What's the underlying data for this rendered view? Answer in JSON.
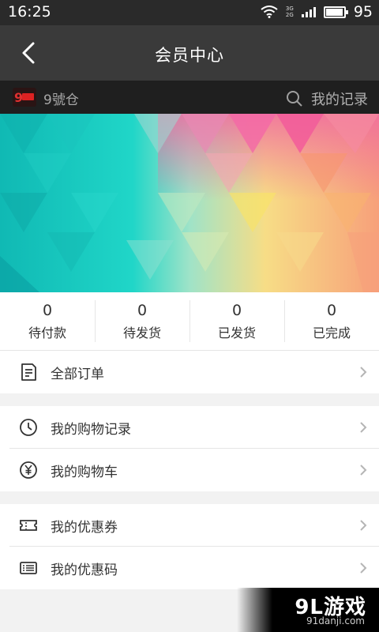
{
  "status_bar": {
    "time": "16:25",
    "network_3g": "3G",
    "network_2g": "2G",
    "battery_level": "95",
    "battery_fraction": 0.95
  },
  "nav": {
    "title": "会员中心"
  },
  "sub_bar": {
    "brand": "9號仓",
    "records_label": "我的记录"
  },
  "order_stats": [
    {
      "count": "0",
      "label": "待付款"
    },
    {
      "count": "0",
      "label": "待发货"
    },
    {
      "count": "0",
      "label": "已发货"
    },
    {
      "count": "0",
      "label": "已完成"
    }
  ],
  "menu": {
    "all_orders": "全部订单",
    "purchase_history": "我的购物记录",
    "cart": "我的购物车",
    "coupons": "我的优惠券",
    "promo_codes": "我的优惠码"
  },
  "watermark": {
    "logo_text": "9L游戏",
    "site": "91danji.com"
  },
  "colors": {
    "nav_bg": "#3a3a3a",
    "status_bg": "#2a2a2a",
    "sub_bar_bg": "#1f1f1f",
    "text": "#333333"
  },
  "icons": [
    "back-arrow-icon",
    "wifi-icon",
    "signal-icon",
    "battery-icon",
    "brand-logo-icon",
    "search-icon",
    "order-list-icon",
    "clock-icon",
    "yen-coin-icon",
    "coupon-icon",
    "promo-code-icon",
    "chevron-right-icon"
  ]
}
